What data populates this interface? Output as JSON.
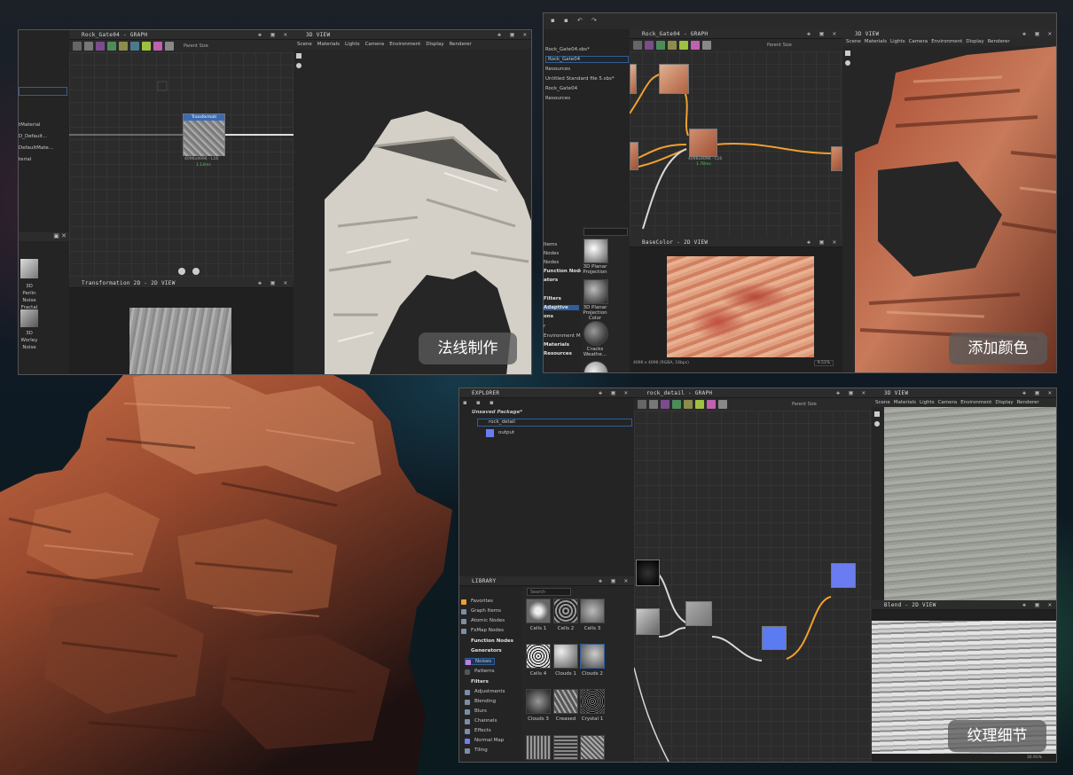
{
  "captions": {
    "normal": "法线制作",
    "color": "添加颜色",
    "detail": "纹理细节"
  },
  "panel1": {
    "graph_title": "Rock_Gate04 - GRAPH",
    "view3d_title": "3D VIEW",
    "parent_size": "Parent Size",
    "menu": [
      "Scene",
      "Materials",
      "Lights",
      "Camera",
      "Environment",
      "Display",
      "Renderer"
    ],
    "explorer_items": [
      "tMaterial",
      "D_Default...",
      "DefaultMate...",
      "terial"
    ],
    "node_title": "Transformati",
    "node_size": "4096x4096 - L16",
    "node_time": "1.14ms",
    "lib_items": [
      {
        "label": "3D Perlin Noise Fractal"
      },
      {
        "label": "3D Worley Noise"
      }
    ],
    "view2d_title": "Transformation 2D - 2D VIEW"
  },
  "panel2": {
    "graph_title": "Rock_Gate04 - GRAPH",
    "view3d_title": "3D VIEW",
    "parent_size": "Parent Size",
    "menu": [
      "Scene",
      "Materials",
      "Lights",
      "Camera",
      "Environment",
      "Display",
      "Renderer"
    ],
    "explorer_items": [
      "Rock_Gate04.sbs*",
      "Rock_Gate04",
      "Resources",
      "Untitled Standard file 5.sbs*",
      "Rock_Gate04",
      "Resources"
    ],
    "node_size": "4096x4096 - L16",
    "node_time": "1.78ms",
    "lib_categories": [
      "Items",
      "Nodes",
      "Nodes",
      "Function Nodes",
      "ators",
      "Filters",
      "Adaptive",
      "ons",
      "r",
      "Environment Maps",
      "Materials",
      "Resources"
    ],
    "lib_thumbs": [
      "3D Planar Projection",
      "3D Planar Projection Color",
      "Cracks Weathe...",
      "Debris"
    ],
    "view2d_title": "BaseColor - 2D VIEW",
    "view2d_status": "4096 x 4096 (RGBA, 16bpc)",
    "zoom": "9.51%"
  },
  "panel3": {
    "explorer_title": "EXPLORER",
    "package": "Unsaved Package*",
    "graph": "rock_detail",
    "output": "output",
    "graph_title": "rock_detail - GRAPH",
    "view3d_title": "3D VIEW",
    "parent_size": "Parent Size",
    "menu": [
      "Scene",
      "Materials",
      "Lights",
      "Camera",
      "Environment",
      "Display",
      "Renderer"
    ],
    "library_title": "LIBRARY",
    "search_placeholder": "Search",
    "library": [
      {
        "label": "Favorites",
        "head": false
      },
      {
        "label": "Graph Items",
        "head": false
      },
      {
        "label": "Atomic Nodes",
        "head": false
      },
      {
        "label": "FxMap Nodes",
        "head": false
      },
      {
        "label": "Function Nodes",
        "head": true
      },
      {
        "label": "Generators",
        "head": true
      },
      {
        "label": "Noises",
        "head": false
      },
      {
        "label": "Patterns",
        "head": false
      },
      {
        "label": "Filters",
        "head": true
      },
      {
        "label": "Adjustments",
        "head": false
      },
      {
        "label": "Blending",
        "head": false
      },
      {
        "label": "Blurs",
        "head": false
      },
      {
        "label": "Channels",
        "head": false
      },
      {
        "label": "Effects",
        "head": false
      },
      {
        "label": "Normal Map",
        "head": false
      },
      {
        "label": "Tiling",
        "head": false
      }
    ],
    "thumbs": [
      "Cells 1",
      "Cells 2",
      "Cells 3",
      "Cells 4",
      "Clouds 1",
      "Clouds 2",
      "Clouds 3",
      "Creased",
      "Crystal 1"
    ],
    "view2d_title": "Blend - 2D VIEW",
    "zoom": "30.91%"
  },
  "colors": {
    "accent_orange": "#f0a030",
    "wire_white": "#d8d8d8",
    "node_blue": "#5a7cf0",
    "selection_blue": "#2e5f9c"
  }
}
